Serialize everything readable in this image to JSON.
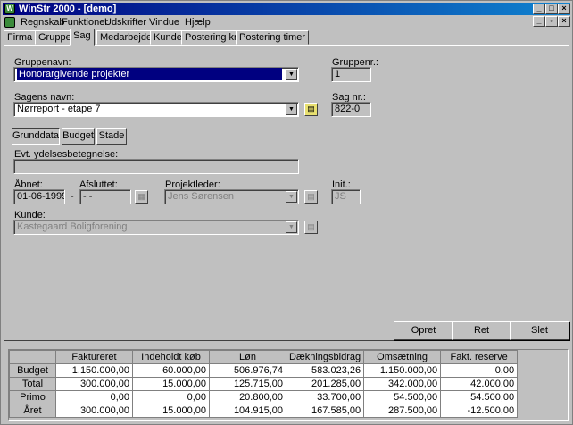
{
  "window": {
    "title": "WinStr 2000 - [demo]"
  },
  "menu": [
    "Regnskab",
    "Funktioner",
    "Udskrifter",
    "Vindue",
    "Hjælp"
  ],
  "tabs": [
    "Firma",
    "Gruppe",
    "Sag",
    "Medarbejder",
    "Kunde",
    "Postering kr.",
    "Postering timer"
  ],
  "form": {
    "gruppenavn_label": "Gruppenavn:",
    "gruppenavn_value": "Honorargivende projekter",
    "gruppenr_label": "Gruppenr.:",
    "gruppenr_value": "1",
    "sagens_navn_label": "Sagens navn:",
    "sagens_navn_value": "Nørreport - etape 7",
    "sag_nr_label": "Sag nr.:",
    "sag_nr_value": "822-0",
    "subtabs": [
      "Grunddata",
      "Budget",
      "Stade"
    ],
    "ydelse_label": "Evt. ydelsesbetegnelse:",
    "ydelse_value": "",
    "aabnet_label": "Åbnet:",
    "aabnet_value": "01-06-1999",
    "dash": "-",
    "afsluttet_label": "Afsluttet:",
    "afsluttet_value": "- -",
    "projektleder_label": "Projektleder:",
    "projektleder_value": "Jens Sørensen",
    "init_label": "Init.:",
    "init_value": "JS",
    "kunde_label": "Kunde:",
    "kunde_value": "Kastegaard Boligforening"
  },
  "buttons": {
    "opret": "Opret",
    "ret": "Ret",
    "slet": "Slet"
  },
  "summary": {
    "columns": [
      "Faktureret",
      "Indeholdt køb",
      "Løn",
      "Dækningsbidrag",
      "Omsætning",
      "Fakt. reserve"
    ],
    "rows": [
      {
        "label": "Budget",
        "values": [
          "1.150.000,00",
          "60.000,00",
          "506.976,74",
          "583.023,26",
          "1.150.000,00",
          "0,00"
        ]
      },
      {
        "label": "Total",
        "values": [
          "300.000,00",
          "15.000,00",
          "125.715,00",
          "201.285,00",
          "342.000,00",
          "42.000,00"
        ]
      },
      {
        "label": "Primo",
        "values": [
          "0,00",
          "0,00",
          "20.800,00",
          "33.700,00",
          "54.500,00",
          "54.500,00"
        ]
      },
      {
        "label": "Året",
        "values": [
          "300.000,00",
          "15.000,00",
          "104.915,00",
          "167.585,00",
          "287.500,00",
          "-12.500,00"
        ]
      }
    ]
  }
}
